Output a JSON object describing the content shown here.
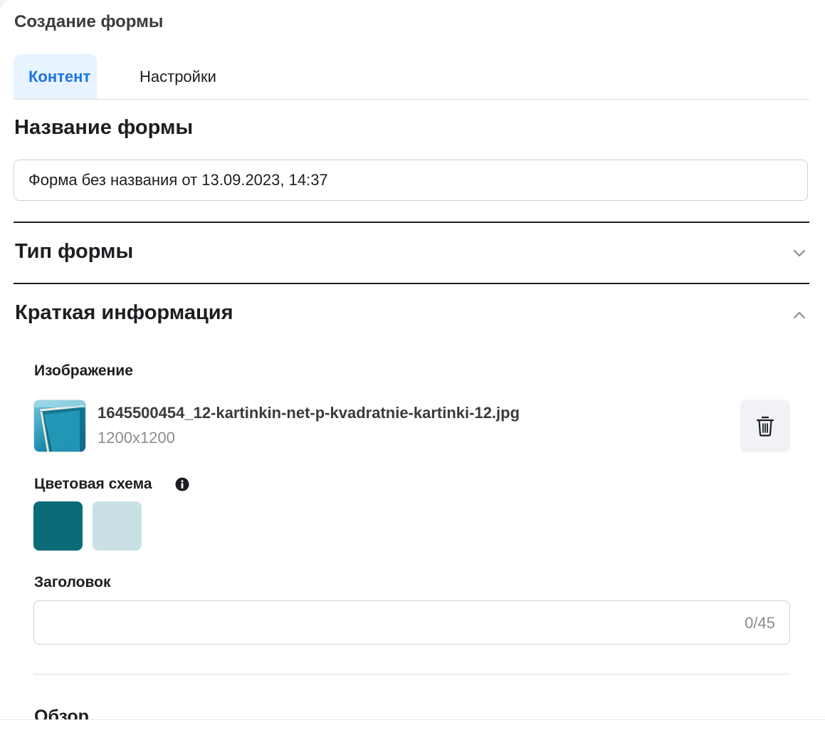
{
  "page": {
    "title": "Создание формы"
  },
  "tabs": [
    {
      "label": "Контент",
      "active": true
    },
    {
      "label": "Настройки",
      "active": false
    }
  ],
  "form_name": {
    "title": "Название формы",
    "value": "Форма без названия от 13.09.2023, 14:37"
  },
  "form_type": {
    "title": "Тип формы",
    "icon": "chevron-down-icon"
  },
  "brief_info": {
    "title": "Краткая информация",
    "icon": "chevron-up-icon",
    "image": {
      "label": "Изображение",
      "file_name": "1645500454_12-kartinkin-net-p-kvadratnie-kartinki-12.jpg",
      "dimensions": "1200x1200",
      "delete_icon": "trash-icon"
    },
    "color_scheme": {
      "label": "Цветовая схема",
      "info_icon": "info-icon",
      "colors": [
        "#0b6b79",
        "#c9e1e4"
      ]
    },
    "headline": {
      "label": "Заголовок",
      "value": "",
      "counter": "0/45"
    },
    "overview": {
      "label": "Обзор"
    }
  },
  "colors": {
    "accent": "#1b74e4",
    "tab_active_bg": "#e7f3ff"
  }
}
